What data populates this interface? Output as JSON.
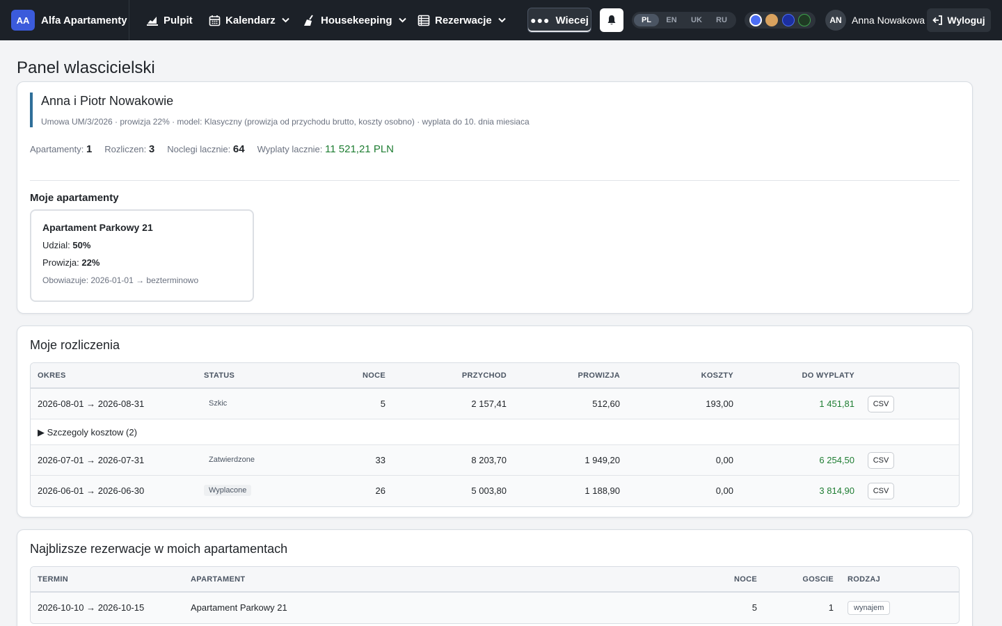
{
  "nav": {
    "brand_initials": "AA",
    "brand_name": "Alfa Apartamenty",
    "items": [
      {
        "label": "Pulpit",
        "icon": "chart-icon"
      },
      {
        "label": "Kalendarz",
        "icon": "calendar-icon"
      },
      {
        "label": "Housekeeping",
        "icon": "broom-icon"
      },
      {
        "label": "Rezerwacje",
        "icon": "list-icon"
      }
    ],
    "more_label": "Wiecej",
    "languages": [
      "PL",
      "EN",
      "UK",
      "RU"
    ],
    "active_language": "PL",
    "theme_colors": [
      "#4c6ef5",
      "#d9a25f",
      "#1c2fa0",
      "#1f5a2a"
    ],
    "user_initials": "AN",
    "user_name": "Anna Nowakowa",
    "logout_label": "Wyloguj"
  },
  "page": {
    "title": "Panel wlascicielski"
  },
  "owner": {
    "name": "Anna i Piotr Nowakowie",
    "meta": "Umowa UM/3/2026 · prowizja 22% · model: Klasyczny (prowizja od przychodu brutto, koszty osobno) · wyplata do 10. dnia miesiaca",
    "stats": {
      "apartments_label": "Apartamenty:",
      "apartments": "1",
      "settlements_label": "Rozliczen:",
      "settlements": "3",
      "nights_label": "Noclegi lacznie:",
      "nights": "64",
      "payouts_label": "Wyplaty lacznie:",
      "payouts": "11 521,21 PLN"
    }
  },
  "apartments": {
    "heading": "Moje apartamenty",
    "items": [
      {
        "name": "Apartament Parkowy 21",
        "share_label": "Udzial:",
        "share": "50%",
        "commission_label": "Prowizja:",
        "commission": "22%",
        "valid": "Obowiazuje: 2026-01-01 → bezterminowo"
      }
    ]
  },
  "settlements": {
    "title": "Moje rozliczenia",
    "columns": [
      "OKRES",
      "STATUS",
      "NOCE",
      "PRZYCHOD",
      "PROWIZJA",
      "KOSZTY",
      "DO WYPLATY"
    ],
    "csv_label": "CSV",
    "rows": [
      {
        "period": "2026-08-01 → 2026-08-31",
        "status": "Szkic",
        "nights": "5",
        "revenue": "2 157,41",
        "commission": "512,60",
        "costs": "193,00",
        "payout": "1 451,81"
      },
      {
        "period": "2026-07-01 → 2026-07-31",
        "status": "Zatwierdzone",
        "nights": "33",
        "revenue": "8 203,70",
        "commission": "1 949,20",
        "costs": "0,00",
        "payout": "6 254,50"
      },
      {
        "period": "2026-06-01 → 2026-06-30",
        "status": "Wyplacone",
        "nights": "26",
        "revenue": "5 003,80",
        "commission": "1 188,90",
        "costs": "0,00",
        "payout": "3 814,90"
      }
    ],
    "cost_details": "▶ Szczegoly kosztow (2)"
  },
  "reservations": {
    "title": "Najblizsze rezerwacje w moich apartamentach",
    "columns": [
      "TERMIN",
      "APARTAMENT",
      "NOCE",
      "GOSCIE",
      "RODZAJ"
    ],
    "rows": [
      {
        "term": "2026-10-10 → 2026-10-15",
        "apartment": "Apartament Parkowy 21",
        "nights": "5",
        "guests": "1",
        "type": "wynajem"
      }
    ]
  },
  "colors": {
    "nav_bg": "#1c2128",
    "brand_badge": "#3b5bdb",
    "accent_border": "#2f6f99",
    "positive": "#1e7d32"
  }
}
